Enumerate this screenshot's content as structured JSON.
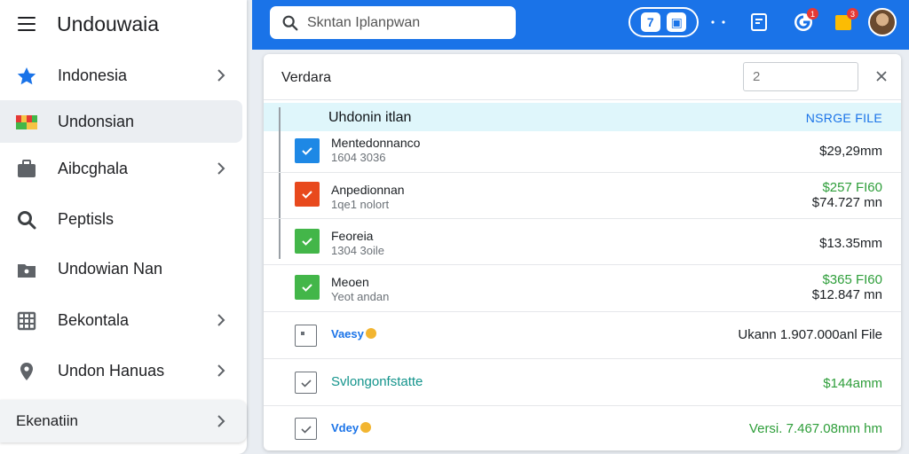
{
  "app": {
    "title": "Undouwaia"
  },
  "search": {
    "placeholder": "Skntan Iplanpwan"
  },
  "toolbar": {
    "pill_buttons": [
      "7",
      "▣"
    ],
    "notif_badge_1": "1",
    "notif_badge_2": "3"
  },
  "sidebar": {
    "items": [
      {
        "label": "Indonesia",
        "icon": "star-icon",
        "chevron": true,
        "active": false
      },
      {
        "label": "Undonsian",
        "icon": "flag-icon",
        "chevron": false,
        "active": true
      },
      {
        "label": "Aibcghala",
        "icon": "briefcase-icon",
        "chevron": true,
        "active": false
      },
      {
        "label": "Peptisls",
        "icon": "search-icon",
        "chevron": false,
        "active": false
      },
      {
        "label": "Undowian Nan",
        "icon": "folder-icon",
        "chevron": false,
        "active": false
      },
      {
        "label": "Bekontala",
        "icon": "calendar-grid-icon",
        "chevron": true,
        "active": false
      },
      {
        "label": "Undon  Hanuas",
        "icon": "location-pin-icon",
        "chevron": true,
        "active": false
      }
    ],
    "settings_label": "Ekenatiin"
  },
  "panel": {
    "title": "Verdara",
    "quantity_value": "2",
    "group_title": "Uhdonin itlan",
    "group_action": "NSRGE FILE",
    "rows": [
      {
        "name": "Mentedonnanco",
        "sub": "1604 3036",
        "amount": "$29,29mm",
        "amount2": "",
        "checkbox": "checked-blue"
      },
      {
        "name": "Anpedionnan",
        "sub": "1qe1 nolort",
        "amount": "$257 FI60",
        "amount2": "$74.727 mn",
        "checkbox": "checked-red"
      },
      {
        "name": "Feoreia",
        "sub": "1304 3oile",
        "amount": "$13.35mm",
        "amount2": "",
        "checkbox": "checked-green"
      },
      {
        "name": "Meoen",
        "sub": "Yeot andan",
        "amount": "$365 FI60",
        "amount2": "$12.847 mn",
        "checkbox": "checked-green"
      },
      {
        "name": "Vaesy",
        "sub": "",
        "amount": "Ukann  1.907.000anl File",
        "amount2": "",
        "checkbox": "outline-square"
      },
      {
        "name": "Svlongonfstatte",
        "sub": "",
        "amount": "$144amm",
        "amount2": "",
        "checkbox": "outline-check"
      },
      {
        "name": "Vdey",
        "sub": "",
        "amount": "Versi.  7.467.08mm hm",
        "amount2": "",
        "checkbox": "outline-check"
      }
    ]
  },
  "colors": {
    "topbar": "#1a73e8",
    "checkbox_blue": "#1e88e5",
    "checkbox_red": "#e8491d",
    "checkbox_green": "#43b649",
    "amount_green": "#2e9e3a",
    "sidebar_active": "#ebeef2"
  }
}
